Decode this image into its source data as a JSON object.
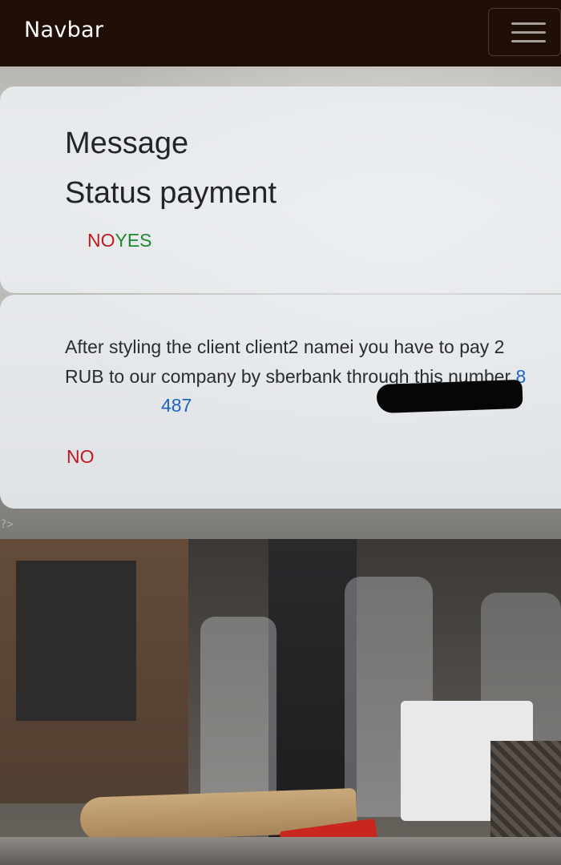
{
  "navbar": {
    "brand": "Navbar",
    "toggler_icon": "hamburger-menu-icon"
  },
  "status_card": {
    "title_line1": "Message",
    "title_line2": "Status payment",
    "no_label": "NO",
    "yes_label": "YES"
  },
  "message_card": {
    "text": "After styling the client client2 namei you have to pay 2 RUB to our company by sberbank through this number ",
    "phone_visible": "8",
    "phone_tail": "487",
    "no_label": "NO"
  },
  "footer_fragment": "?>",
  "colors": {
    "navbar_bg": "#200f06",
    "no": "#c01a1f",
    "yes": "#1e8a2e",
    "link": "#1c63c4"
  }
}
